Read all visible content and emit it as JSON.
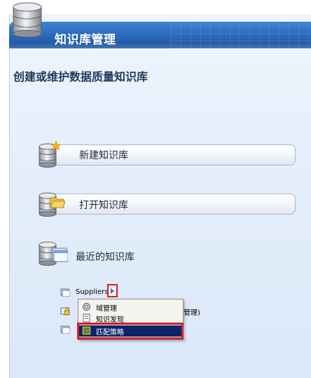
{
  "header": {
    "title": "知识库管理"
  },
  "subtitle": "创建或维护数据质量知识库",
  "actions": [
    {
      "label": "新建知识库",
      "icon": "new-database-icon"
    },
    {
      "label": "打开知识库",
      "icon": "open-database-icon"
    }
  ],
  "recent": {
    "title": "最近的知识库",
    "icon": "recent-database-icon",
    "items": [
      {
        "label": "Suppliers",
        "icon": "database-small-icon"
      },
      {
        "label": "管理)",
        "icon": "locked-database-icon"
      },
      {
        "label": "",
        "icon": "database-small-icon"
      }
    ]
  },
  "context_menu": {
    "items": [
      {
        "label": "域管理",
        "icon": "domain-management-icon"
      },
      {
        "label": "知识发现",
        "icon": "knowledge-discovery-icon"
      },
      {
        "label": "匹配策略",
        "icon": "matching-policy-icon",
        "selected": true
      }
    ]
  },
  "colors": {
    "header_blue": "#2a67b9",
    "highlight_red": "#d41f2b",
    "menu_selected": "#0a246a"
  }
}
